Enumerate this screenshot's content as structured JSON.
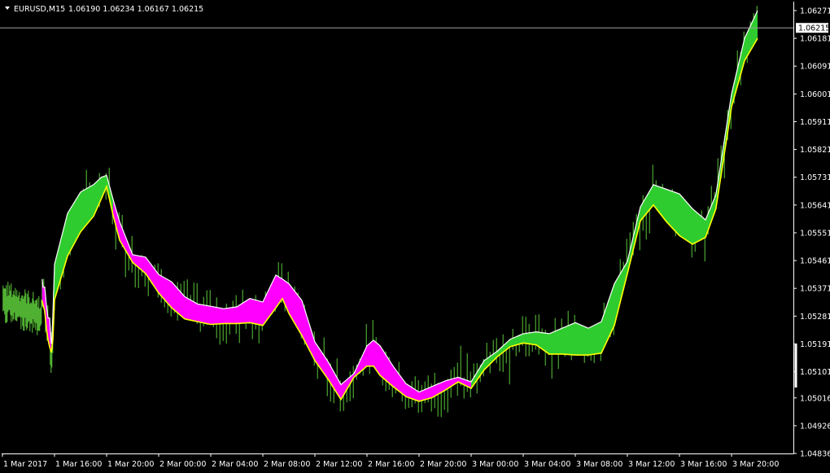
{
  "header": {
    "symbol": "EURUSD,M15",
    "ohlc": "1.06190 1.06234 1.06167 1.06215"
  },
  "colors": {
    "background": "#000000",
    "axis": "#ffffff",
    "ticks": "#5cc83a",
    "band_up": "#2fcc2f",
    "band_down": "#ff00ff",
    "edge_up": "#ffffff",
    "edge_low": "#ffff00",
    "current_line": "#a0a0a0"
  },
  "chart_data": {
    "type": "line",
    "title": "EURUSD,M15",
    "ylim": [
      1.04836,
      1.06271
    ],
    "y_ticks": [
      {
        "label": "1.06271",
        "value": 1.06271
      },
      {
        "label": "1.06181",
        "value": 1.06181
      },
      {
        "label": "1.06091",
        "value": 1.06091
      },
      {
        "label": "1.06001",
        "value": 1.06001
      },
      {
        "label": "1.05911",
        "value": 1.05911
      },
      {
        "label": "1.05821",
        "value": 1.05821
      },
      {
        "label": "1.05731",
        "value": 1.05731
      },
      {
        "label": "1.05641",
        "value": 1.05641
      },
      {
        "label": "1.05551",
        "value": 1.05551
      },
      {
        "label": "1.05461",
        "value": 1.05461
      },
      {
        "label": "1.05371",
        "value": 1.05371
      },
      {
        "label": "1.05281",
        "value": 1.05281
      },
      {
        "label": "1.05191",
        "value": 1.05191
      },
      {
        "label": "1.05101",
        "value": 1.05101
      },
      {
        "label": "1.05016",
        "value": 1.05016
      },
      {
        "label": "1.04926",
        "value": 1.04926
      },
      {
        "label": "1.04836",
        "value": 1.04836
      }
    ],
    "x_ticks": [
      {
        "label": "1 Mar 2017",
        "hour": 0
      },
      {
        "label": "1 Mar 16:00",
        "hour": 16
      },
      {
        "label": "1 Mar 20:00",
        "hour": 20
      },
      {
        "label": "2 Mar 00:00",
        "hour": 24
      },
      {
        "label": "2 Mar 04:00",
        "hour": 28
      },
      {
        "label": "2 Mar 08:00",
        "hour": 32
      },
      {
        "label": "2 Mar 12:00",
        "hour": 36
      },
      {
        "label": "2 Mar 16:00",
        "hour": 40
      },
      {
        "label": "2 Mar 20:00",
        "hour": 44
      },
      {
        "label": "3 Mar 00:00",
        "hour": 48
      },
      {
        "label": "3 Mar 04:00",
        "hour": 52
      },
      {
        "label": "3 Mar 08:00",
        "hour": 56
      },
      {
        "label": "3 Mar 12:00",
        "hour": 60
      },
      {
        "label": "3 Mar 16:00",
        "hour": 64
      },
      {
        "label": "3 Mar 20:00",
        "hour": 68
      }
    ],
    "current_price": {
      "label": "1.06215",
      "value": 1.06215
    },
    "band": {
      "hour": [
        12.2,
        12.5,
        13.0,
        13.5,
        14.0,
        14.5,
        15.0,
        15.2,
        15.5,
        16.0,
        17.0,
        18.0,
        19.0,
        19.6,
        20.0,
        20.5,
        21.0,
        22.0,
        23.0,
        24.0,
        25.0,
        26.0,
        27.0,
        28.0,
        29.0,
        30.0,
        31.0,
        32.0,
        33.0,
        33.5,
        34.0,
        35.0,
        36.0,
        37.0,
        38.0,
        39.0,
        40.0,
        40.5,
        41.0,
        42.0,
        43.0,
        44.0,
        45.0,
        46.0,
        47.0,
        48.0,
        49.0,
        50.0,
        51.0,
        52.0,
        53.0,
        54.0,
        55.0,
        56.0,
        57.0,
        58.0,
        59.0,
        60.0,
        61.0,
        62.0,
        63.0,
        64.0,
        65.0,
        66.0,
        66.8,
        68.0,
        69.0,
        70.0
      ],
      "upper": [
        1.05401,
        1.05374,
        1.05375,
        1.05318,
        1.05275,
        1.05275,
        1.05191,
        1.05203,
        1.05287,
        1.05449,
        1.05614,
        1.05683,
        1.05707,
        1.05731,
        1.05737,
        1.05659,
        1.05587,
        1.0548,
        1.05472,
        1.05416,
        1.05392,
        1.05344,
        1.0532,
        1.05313,
        1.05305,
        1.05311,
        1.05338,
        1.05327,
        1.05414,
        1.05401,
        1.05386,
        1.05332,
        1.05197,
        1.05134,
        1.05059,
        1.05095,
        1.05185,
        1.05203,
        1.05185,
        1.05119,
        1.05062,
        1.05035,
        1.05053,
        1.05071,
        1.05083,
        1.05068,
        1.05137,
        1.05167,
        1.05206,
        1.05224,
        1.0523,
        1.05224,
        1.05242,
        1.0526,
        1.05242,
        1.05263,
        1.05386,
        1.05458,
        1.05635,
        1.05707,
        1.05692,
        1.05677,
        1.05629,
        1.05593,
        1.05674,
        1.06001,
        1.06181,
        1.06271
      ],
      "lower": [
        1.05331,
        1.05316,
        1.05298,
        1.05241,
        1.05205,
        1.05181,
        1.05164,
        1.05176,
        1.05206,
        1.05334,
        1.05476,
        1.05554,
        1.05605,
        1.05662,
        1.05701,
        1.05608,
        1.05527,
        1.05455,
        1.05419,
        1.05356,
        1.05308,
        1.05272,
        1.05263,
        1.05254,
        1.05257,
        1.05257,
        1.0526,
        1.05251,
        1.05308,
        1.05338,
        1.0529,
        1.05218,
        1.05137,
        1.05077,
        1.05011,
        1.05083,
        1.05119,
        1.05119,
        1.05089,
        1.05053,
        1.0502,
        1.05005,
        1.05017,
        1.05041,
        1.05068,
        1.05047,
        1.05107,
        1.05149,
        1.05182,
        1.05194,
        1.05188,
        1.05158,
        1.05158,
        1.05155,
        1.05155,
        1.05161,
        1.05251,
        1.05419,
        1.0559,
        1.05641,
        1.05587,
        1.05542,
        1.05514,
        1.05536,
        1.05629,
        1.05959,
        1.06109,
        1.06181
      ],
      "up_ranges": [
        [
          15.0,
          20.0
        ],
        [
          48.0,
          70.0
        ]
      ]
    }
  }
}
